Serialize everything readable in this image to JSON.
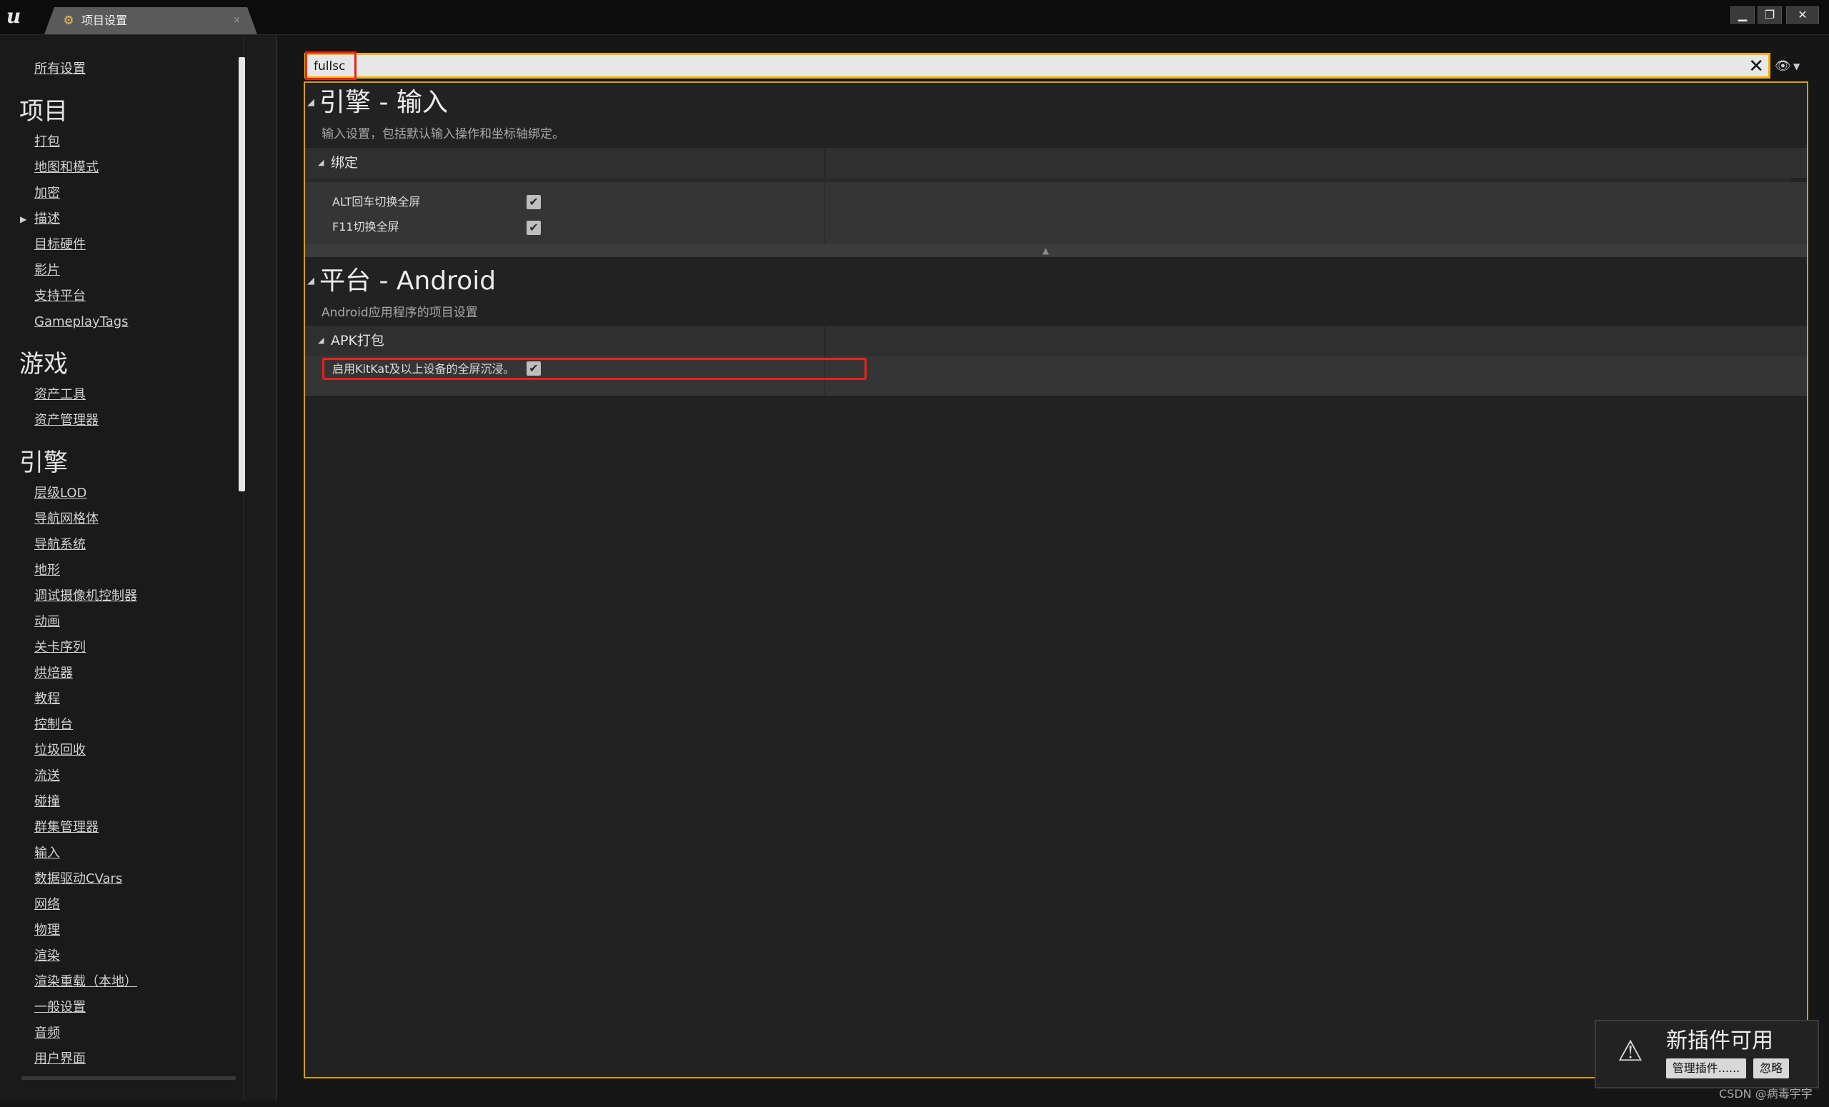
{
  "window": {
    "tab_label": "项目设置",
    "tab_close": "×",
    "logo_glyph": "u",
    "tab_icon": "gear-icon",
    "controls": {
      "minimize": "▁",
      "maximize": "❐",
      "close": "✕"
    }
  },
  "sidebar": {
    "all_settings": "所有设置",
    "project": {
      "heading": "项目",
      "items": [
        "打包",
        "地图和模式",
        "加密",
        "描述",
        "目标硬件",
        "影片",
        "支持平台",
        "GameplayTags"
      ]
    },
    "game": {
      "heading": "游戏",
      "items": [
        "资产工具",
        "资产管理器"
      ]
    },
    "engine": {
      "heading": "引擎",
      "items": [
        "层级LOD",
        "导航网格体",
        "导航系统",
        "地形",
        "调试摄像机控制器",
        "动画",
        "关卡序列",
        "烘焙器",
        "教程",
        "控制台",
        "垃圾回收",
        "流送",
        "碰撞",
        "群集管理器",
        "输入",
        "数据驱动CVars",
        "网络",
        "物理",
        "渲染",
        "渲染重载（本地）",
        "一般设置",
        "音频",
        "用户界面"
      ]
    }
  },
  "search": {
    "value": "fullsc",
    "clear_glyph": "✕",
    "eye_glyph": "👁",
    "caret_glyph": "▼"
  },
  "sections": {
    "engine_input": {
      "title": "引擎 - 输入",
      "description": "输入设置，包括默认输入操作和坐标轴绑定。",
      "category": "绑定",
      "props": [
        {
          "label": "ALT回车切换全屏",
          "checked": true
        },
        {
          "label": "F11切换全屏",
          "checked": true
        }
      ]
    },
    "platform_android": {
      "title": "平台 - Android",
      "description": "Android应用程序的项目设置",
      "category": "APK打包",
      "props": [
        {
          "label": "启用KitKat及以上设备的全屏沉浸。",
          "checked": true
        }
      ]
    }
  },
  "glyphs": {
    "expanded": "◢",
    "collapsed": "▶",
    "check": "✔",
    "collapse_up": "▲",
    "warning": "⚠"
  },
  "toast": {
    "title": "新插件可用",
    "manage_button": "管理插件......",
    "dismiss_button": "忽略"
  },
  "watermark": "CSDN @病毒宇宇",
  "colors": {
    "search_border": "#f7b200",
    "highlight_red": "#e8231e",
    "panel_border": "#d7a000"
  }
}
